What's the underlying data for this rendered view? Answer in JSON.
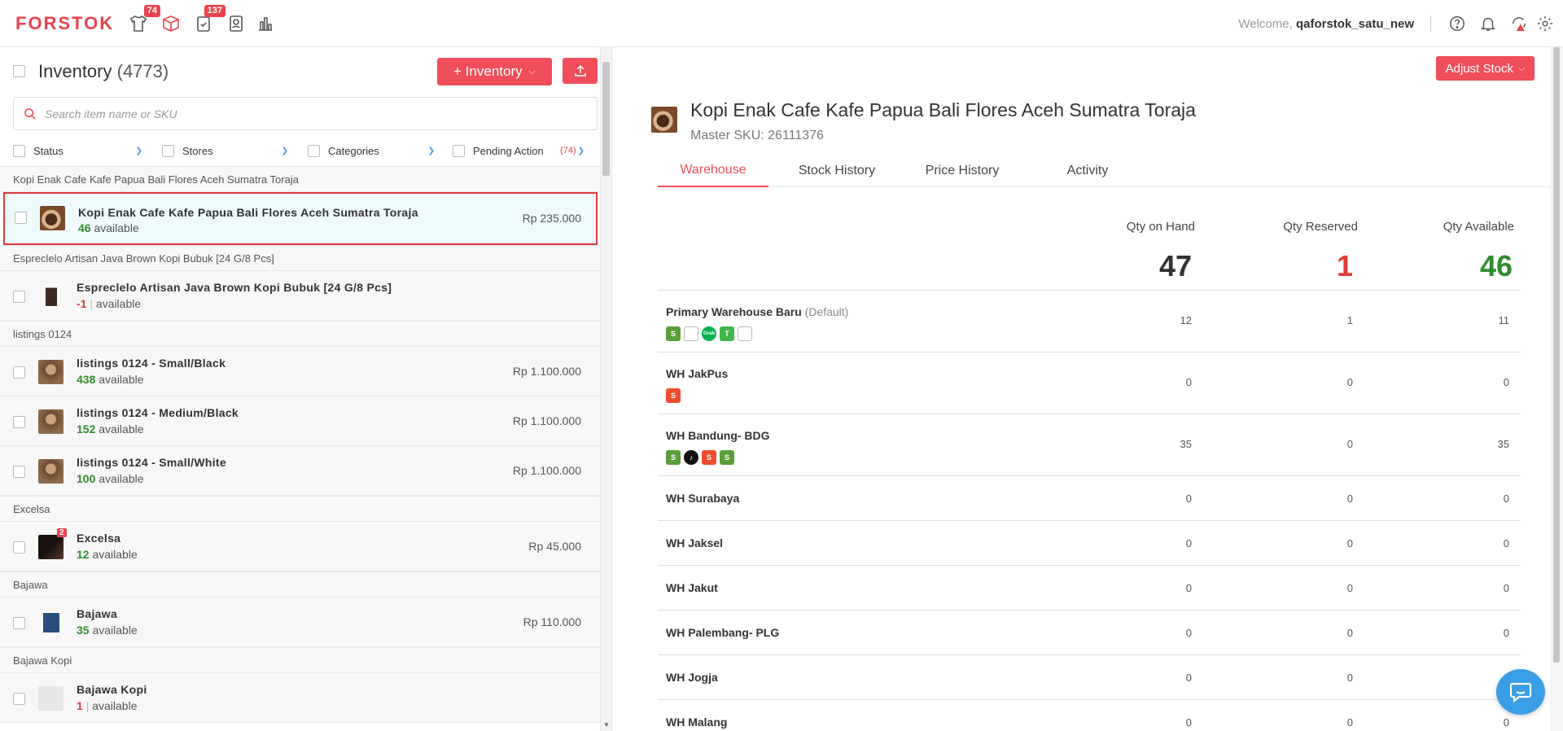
{
  "app": {
    "logo": "FORSTOK",
    "nav_badges": {
      "products": "74",
      "orders": "137"
    },
    "welcome_prefix": "Welcome,",
    "username": "qaforstok_satu_new",
    "brand_color": "#e8434c"
  },
  "inventory": {
    "title": "Inventory",
    "count": "(4773)",
    "add_button": "+ Inventory",
    "search_placeholder": "Search item name or SKU",
    "filters": {
      "status": "Status",
      "stores": "Stores",
      "categories": "Categories",
      "pending_action": "Pending Action",
      "pending_count": "(74)"
    },
    "available_word": "available",
    "groups": [
      {
        "header": "Kopi Enak Cafe Kafe Papua Bali Flores Aceh Sumatra Toraja",
        "items": [
          {
            "name": "Kopi Enak Cafe Kafe Papua Bali Flores Aceh Sumatra Toraja",
            "qty": "46",
            "price": "Rp 235.000"
          }
        ]
      },
      {
        "header": "Espreclelo Artisan Java Brown Kopi Bubuk [24 G/8 Pcs]",
        "items": [
          {
            "name": "Espreclelo Artisan Java Brown Kopi Bubuk [24 G/8 Pcs]",
            "qty": "-1",
            "price": ""
          }
        ]
      },
      {
        "header": "listings 0124",
        "items": [
          {
            "name": "listings 0124 - Small/Black",
            "qty": "438",
            "price": "Rp 1.100.000"
          },
          {
            "name": "listings 0124 - Medium/Black",
            "qty": "152",
            "price": "Rp 1.100.000"
          },
          {
            "name": "listings 0124 - Small/White",
            "qty": "100",
            "price": "Rp 1.100.000"
          }
        ]
      },
      {
        "header": "Excelsa",
        "items": [
          {
            "name": "Excelsa",
            "qty": "12",
            "price": "Rp 45.000",
            "badge": "2"
          }
        ]
      },
      {
        "header": "Bajawa",
        "items": [
          {
            "name": "Bajawa",
            "qty": "35",
            "price": "Rp 110.000"
          }
        ]
      },
      {
        "header": "Bajawa Kopi",
        "items": [
          {
            "name": "Bajawa Kopi",
            "qty": "1",
            "price": ""
          }
        ]
      }
    ]
  },
  "detail": {
    "adjust_button": "Adjust Stock",
    "title": "Kopi Enak Cafe Kafe Papua Bali Flores Aceh Sumatra Toraja",
    "master_sku": "Master SKU: 26111376",
    "tabs": [
      "Warehouse",
      "Stock History",
      "Price History",
      "Activity"
    ],
    "headers": {
      "on_hand": "Qty on Hand",
      "reserved": "Qty Reserved",
      "available": "Qty Available"
    },
    "totals": {
      "on_hand": "47",
      "reserved": "1",
      "available": "46"
    },
    "default_label": "(Default)",
    "warehouses": [
      {
        "name": "Primary Warehouse Baru",
        "on_hand": "12",
        "reserved": "1",
        "available": "11",
        "channels": [
          "shopify",
          "broken",
          "grab",
          "toped",
          "broken"
        ]
      },
      {
        "name": "WH JakPus",
        "on_hand": "0",
        "reserved": "0",
        "available": "0",
        "channels": [
          "shopee"
        ]
      },
      {
        "name": "WH Bandung- BDG",
        "on_hand": "35",
        "reserved": "0",
        "available": "35",
        "channels": [
          "shopify",
          "tiktok",
          "shopee",
          "shopify"
        ]
      },
      {
        "name": "WH Surabaya",
        "on_hand": "0",
        "reserved": "0",
        "available": "0",
        "channels": []
      },
      {
        "name": "WH Jaksel",
        "on_hand": "0",
        "reserved": "0",
        "available": "0",
        "channels": []
      },
      {
        "name": "WH Jakut",
        "on_hand": "0",
        "reserved": "0",
        "available": "0",
        "channels": []
      },
      {
        "name": "WH Palembang- PLG",
        "on_hand": "0",
        "reserved": "0",
        "available": "0",
        "channels": []
      },
      {
        "name": "WH Jogja",
        "on_hand": "0",
        "reserved": "0",
        "available": "0",
        "channels": []
      },
      {
        "name": "WH Malang",
        "on_hand": "0",
        "reserved": "0",
        "available": "0",
        "channels": []
      }
    ]
  }
}
